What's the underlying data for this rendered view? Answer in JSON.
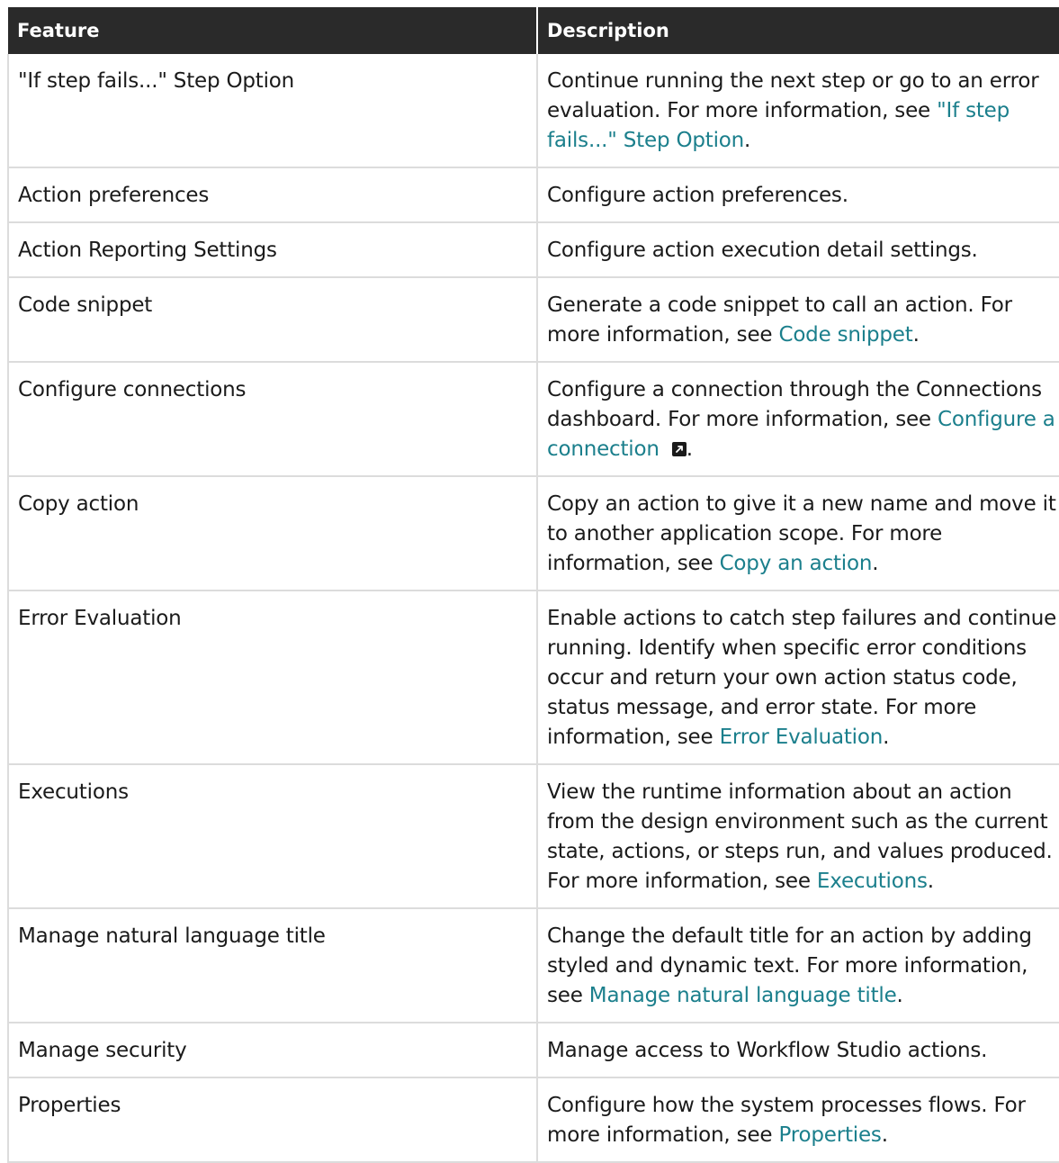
{
  "table": {
    "headers": [
      "Feature",
      "Description"
    ],
    "rows": [
      {
        "feature": "\"If step fails...\" Step Option",
        "desc_text": "Continue running the next step or go to an error evaluation. For more information, see ",
        "desc_link": "\"If step fails...\" Step Option",
        "desc_suffix": "."
      },
      {
        "feature": "Action preferences",
        "desc_text": "Configure action preferences.",
        "desc_link": "",
        "desc_suffix": ""
      },
      {
        "feature": "Action Reporting Settings",
        "desc_text": "Configure action execution detail settings.",
        "desc_link": "",
        "desc_suffix": ""
      },
      {
        "feature": "Code snippet",
        "desc_text": "Generate a code snippet to call an action. For more information, see ",
        "desc_link": "Code snippet",
        "desc_suffix": "."
      },
      {
        "feature": "Configure connections",
        "desc_text": "Configure a connection through the Connections dashboard. For more information, see ",
        "desc_link": "Configure a connection",
        "desc_suffix": ".",
        "external_icon": "external-link-icon"
      },
      {
        "feature": "Copy action",
        "desc_text": "Copy an action to give it a new name and move it to another application scope. For more information, see ",
        "desc_link": "Copy an action",
        "desc_suffix": "."
      },
      {
        "feature": "Error Evaluation",
        "desc_text": "Enable actions to catch step failures and continue running. Identify when specific error conditions occur and return your own action status code, status message, and error state. For more information, see ",
        "desc_link": "Error Evaluation",
        "desc_suffix": "."
      },
      {
        "feature": "Executions",
        "desc_text": "View the runtime information about an action from the design environment such as the current state, actions, or steps run, and values produced. For more information, see ",
        "desc_link": "Executions",
        "desc_suffix": "."
      },
      {
        "feature": "Manage natural language title",
        "desc_text": "Change the default title for an action by adding styled and dynamic text. For more information, see ",
        "desc_link": "Manage natural language title",
        "desc_suffix": "."
      },
      {
        "feature": "Manage security",
        "desc_text": "Manage access to Workflow Studio actions.",
        "desc_link": "",
        "desc_suffix": ""
      },
      {
        "feature": "Properties",
        "desc_text": "Configure how the system processes flows. For more information, see ",
        "desc_link": "Properties",
        "desc_suffix": "."
      }
    ]
  },
  "colors": {
    "header_bg": "#2a2a2a",
    "link": "#1b7f8c",
    "border": "#dcdcdc"
  }
}
